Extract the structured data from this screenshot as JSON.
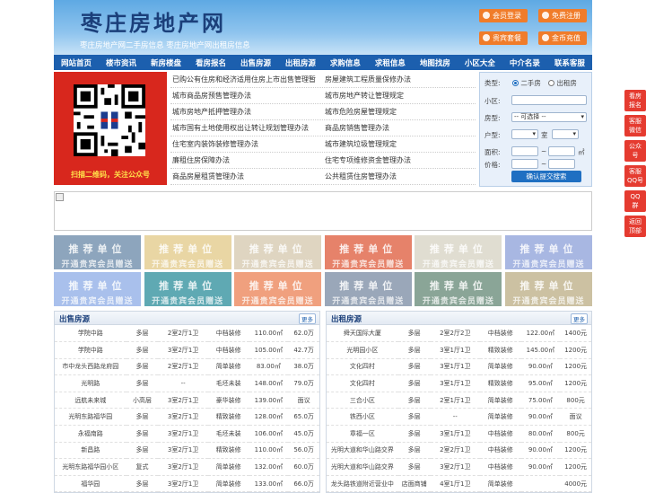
{
  "header": {
    "logo": "枣庄房地产网",
    "slogan": "枣庄房地产网二手房信息    枣庄房地产网出租房信息",
    "buttons": [
      "会员登录",
      "免费注册",
      "贵宾套餐",
      "金币充值"
    ]
  },
  "nav": [
    "网站首页",
    "楼市资讯",
    "新房楼盘",
    "看房报名",
    "出售房源",
    "出租房源",
    "求购信息",
    "求租信息",
    "地图找房",
    "小区大全",
    "中介名录",
    "联系客服"
  ],
  "qr": {
    "caption": "扫描二维码，关注公众号"
  },
  "links": [
    [
      "已购公有住房和经济适用住房上市出售管理暂",
      "房屋建筑工程质量保修办法"
    ],
    [
      "城市商品房预售管理办法",
      "城市房地产转让管理规定"
    ],
    [
      "城市房地产抵押管理办法",
      "城市危险房屋管理规定"
    ],
    [
      "城市国有土地使用权出让转让规划管理办法",
      "商品房销售管理办法"
    ],
    [
      "住宅室内装饰装修管理办法",
      "城市建筑垃圾管理规定"
    ],
    [
      "廉租住房保障办法",
      "住宅专项维修资金管理办法"
    ],
    [
      "商品房屋租赁管理办法",
      "公共租赁住房管理办法"
    ]
  ],
  "search": {
    "type_label": "类型:",
    "opt_sale": "二手房",
    "opt_rent": "出租房",
    "community_label": "小区:",
    "house_label": "房型:",
    "house_select": "-- 可选择 --",
    "layout_label": "户型:",
    "room": "室",
    "area_label": "面积:",
    "area_unit": "㎡",
    "price_label": "价格:",
    "submit": "确认提交搜索"
  },
  "ads": {
    "line1": "推荐单位",
    "line2": "开通贵宾会员赠送",
    "colors": [
      "#8da5bd",
      "#e9d6a4",
      "#dfd5c1",
      "#e6826a",
      "#e0ddd1",
      "#a8b7e2",
      "#a9c0ec",
      "#5fa9b3",
      "#f0a07e",
      "#9aa7b9",
      "#8aa597",
      "#ccc1a2"
    ]
  },
  "sale": {
    "title": "出售房源",
    "more": "更多",
    "rows": [
      [
        "学院中路",
        "多层",
        "2室2厅1卫",
        "中档装修",
        "110.00㎡",
        "62.0万"
      ],
      [
        "学院中路",
        "多层",
        "3室2厅1卫",
        "中档装修",
        "105.00㎡",
        "42.7万"
      ],
      [
        "市中龙头西路龙府园",
        "多层",
        "2室2厅1卫",
        "简单装修",
        "83.00㎡",
        "38.0万"
      ],
      [
        "光明路",
        "多层",
        "--",
        "毛坯未装",
        "148.00㎡",
        "79.0万"
      ],
      [
        "远航未来城",
        "小高层",
        "3室2厅1卫",
        "豪华装修",
        "139.00㎡",
        "面议"
      ],
      [
        "光明东路福华园",
        "多层",
        "3室2厅1卫",
        "精致装修",
        "128.00㎡",
        "65.0万"
      ],
      [
        "永福南路",
        "多层",
        "3室2厅1卫",
        "毛坯未装",
        "106.00㎡",
        "45.0万"
      ],
      [
        "新昌路",
        "多层",
        "3室2厅1卫",
        "精致装修",
        "110.00㎡",
        "56.0万"
      ],
      [
        "光明东路福华园小区",
        "复式",
        "3室2厅1卫",
        "简单装修",
        "132.00㎡",
        "60.0万"
      ],
      [
        "福华园",
        "多层",
        "3室2厅1卫",
        "简单装修",
        "133.00㎡",
        "66.0万"
      ]
    ]
  },
  "rent": {
    "title": "出租房源",
    "more": "更多",
    "rows": [
      [
        "舜天国际大厦",
        "多层",
        "2室2厅2卫",
        "中档装修",
        "122.00㎡",
        "1400元"
      ],
      [
        "光明园小区",
        "多层",
        "3室1厅1卫",
        "精致装修",
        "145.00㎡",
        "1200元"
      ],
      [
        "文化四村",
        "多层",
        "3室1厅1卫",
        "简单装修",
        "90.00㎡",
        "1200元"
      ],
      [
        "文化四村",
        "多层",
        "3室1厅1卫",
        "精致装修",
        "95.00㎡",
        "1200元"
      ],
      [
        "三合小区",
        "多层",
        "2室1厅1卫",
        "简单装修",
        "75.00㎡",
        "800元"
      ],
      [
        "铁西小区",
        "多层",
        "--",
        "简单装修",
        "90.00㎡",
        "面议"
      ],
      [
        "章福一区",
        "多层",
        "3室1厅1卫",
        "中档装修",
        "80.00㎡",
        "800元"
      ],
      [
        "光明大道和华山路交界",
        "多层",
        "2室2厅1卫",
        "中档装修",
        "90.00㎡",
        "1200元"
      ],
      [
        "光明大道和华山路交界",
        "多层",
        "3室2厅1卫",
        "中档装修",
        "90.00㎡",
        "1200元"
      ],
      [
        "龙头路铁道附近营业中",
        "店面商铺",
        "4室1厅1卫",
        "简单装修",
        "",
        "4000元"
      ]
    ]
  },
  "side": [
    [
      "看房",
      "报名"
    ],
    [
      "客服",
      "微信"
    ],
    [
      "公众",
      "号"
    ],
    [
      "客服",
      "QQ号"
    ],
    [
      "QQ",
      "群"
    ],
    [
      "返回",
      "顶部"
    ]
  ]
}
